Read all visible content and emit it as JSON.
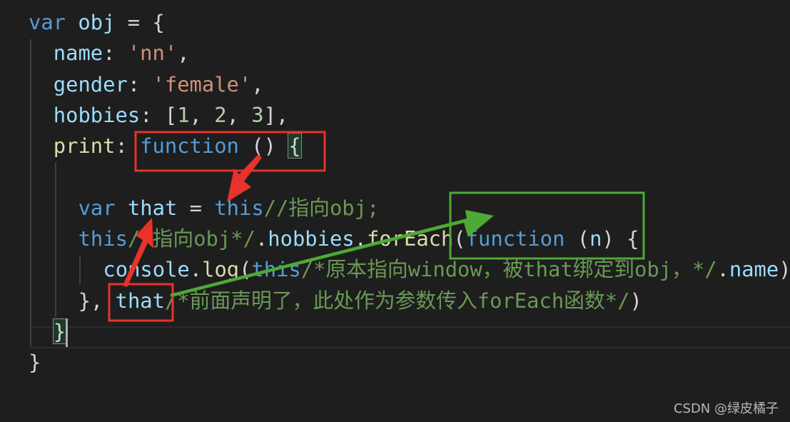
{
  "editor": {
    "colors": {
      "background": "#1e1e1e",
      "keyword": "#569cd6",
      "property": "#9cdcfe",
      "string": "#ce9178",
      "number": "#b5cea8",
      "comment": "#6a9955",
      "function": "#dcdcaa",
      "punctuation": "#d4d4d4"
    },
    "lines": [
      {
        "indent": 0,
        "tokens": [
          [
            "var",
            "kw"
          ],
          [
            " ",
            "pn"
          ],
          [
            "obj",
            "prop"
          ],
          [
            " = {",
            "pn"
          ]
        ]
      },
      {
        "indent": 1,
        "tokens": [
          [
            "name",
            "prop"
          ],
          [
            ": ",
            "pn"
          ],
          [
            "'nn'",
            "str"
          ],
          [
            ",",
            "pn"
          ]
        ]
      },
      {
        "indent": 1,
        "tokens": [
          [
            "gender",
            "prop"
          ],
          [
            ": ",
            "pn"
          ],
          [
            "'female'",
            "str"
          ],
          [
            ",",
            "pn"
          ]
        ]
      },
      {
        "indent": 1,
        "tokens": [
          [
            "hobbies",
            "prop"
          ],
          [
            ": [",
            "pn"
          ],
          [
            "1",
            "num"
          ],
          [
            ", ",
            "pn"
          ],
          [
            "2",
            "num"
          ],
          [
            ", ",
            "pn"
          ],
          [
            "3",
            "num"
          ],
          [
            "],",
            "pn"
          ]
        ]
      },
      {
        "indent": 1,
        "tokens": [
          [
            "print",
            "fn"
          ],
          [
            ": ",
            "pn"
          ],
          [
            "function",
            "kw"
          ],
          [
            " () ",
            "pn"
          ],
          [
            "{",
            "pn match"
          ]
        ]
      },
      {
        "indent": 2,
        "tokens": []
      },
      {
        "indent": 2,
        "tokens": [
          [
            "var",
            "kw"
          ],
          [
            " ",
            "pn"
          ],
          [
            "that",
            "prop"
          ],
          [
            " = ",
            "pn"
          ],
          [
            "this",
            "kw"
          ],
          [
            "//指向obj;",
            "cm"
          ]
        ]
      },
      {
        "indent": 2,
        "tokens": [
          [
            "this",
            "kw"
          ],
          [
            "/*指向obj*/",
            "cm"
          ],
          [
            ".",
            "pn"
          ],
          [
            "hobbies",
            "prop"
          ],
          [
            ".",
            "pn"
          ],
          [
            "forEach",
            "fn"
          ],
          [
            "(",
            "pn"
          ],
          [
            "function",
            "kw"
          ],
          [
            " (",
            "pn"
          ],
          [
            "n",
            "prop"
          ],
          [
            ") {",
            "pn"
          ]
        ]
      },
      {
        "indent": 3,
        "tokens": [
          [
            "console",
            "prop"
          ],
          [
            ".",
            "pn"
          ],
          [
            "log",
            "fn"
          ],
          [
            "(",
            "pn"
          ],
          [
            "this",
            "kw"
          ],
          [
            "/*原本指向window，被that绑定到obj，*/",
            "cm"
          ],
          [
            ".",
            "pn"
          ],
          [
            "name",
            "prop"
          ],
          [
            ")",
            "pn"
          ]
        ]
      },
      {
        "indent": 2,
        "tokens": [
          [
            "}, ",
            "pn"
          ],
          [
            "that",
            "prop"
          ],
          [
            "/*前面声明了，此处作为参数传入forEach函数*/",
            "cm"
          ],
          [
            ")",
            "pn"
          ]
        ]
      },
      {
        "indent": 1,
        "tokens": [
          [
            "}",
            "pn match"
          ]
        ]
      },
      {
        "indent": 0,
        "tokens": [
          [
            "}",
            "pn"
          ]
        ]
      }
    ]
  },
  "annotations": {
    "red": "#e8322a",
    "green": "#4caa35"
  },
  "watermark": "CSDN @绿皮橘子"
}
